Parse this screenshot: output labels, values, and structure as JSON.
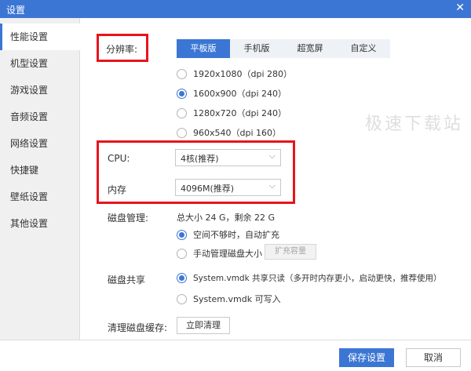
{
  "window": {
    "title": "设置",
    "close_glyph": "✕"
  },
  "sidebar": {
    "items": [
      {
        "label": "性能设置"
      },
      {
        "label": "机型设置"
      },
      {
        "label": "游戏设置"
      },
      {
        "label": "音频设置"
      },
      {
        "label": "网络设置"
      },
      {
        "label": "快捷键"
      },
      {
        "label": "壁纸设置"
      },
      {
        "label": "其他设置"
      }
    ],
    "active": "性能设置"
  },
  "resolution": {
    "label": "分辨率:",
    "tabs": [
      {
        "label": "平板版"
      },
      {
        "label": "手机版"
      },
      {
        "label": "超宽屏"
      },
      {
        "label": "自定义"
      }
    ],
    "active_tab": "平板版",
    "options": [
      {
        "label": "1920x1080（dpi 280）"
      },
      {
        "label": "1600x900（dpi 240）"
      },
      {
        "label": "1280x720（dpi 240）"
      },
      {
        "label": "960x540（dpi 160）"
      }
    ],
    "selected": "1600x900（dpi 240）"
  },
  "cpu": {
    "label": "CPU:",
    "value": "4核(推荐)"
  },
  "memory": {
    "label": "内存",
    "value": "4096M(推荐)"
  },
  "disk": {
    "label": "磁盘管理:",
    "summary": "总大小 24 G，剩余 22 G",
    "options": [
      {
        "label": "空间不够时，自动扩充"
      },
      {
        "label": "手动管理磁盘大小"
      }
    ],
    "selected": "空间不够时，自动扩充",
    "expand_button": "扩充容量"
  },
  "disk_share": {
    "label": "磁盘共享",
    "options": [
      {
        "label": "System.vmdk 共享只读（多开时内存更小，启动更快，推荐使用）"
      },
      {
        "label": "System.vmdk 可写入"
      }
    ],
    "selected": "System.vmdk 共享只读（多开时内存更小，启动更快，推荐使用）"
  },
  "cache": {
    "label": "清理磁盘缓存:",
    "button": "立即清理"
  },
  "footer": {
    "save": "保存设置",
    "cancel": "取消"
  },
  "watermark": "极速下载站",
  "colors": {
    "accent": "#3c76d4",
    "highlight_box": "#e8141b"
  }
}
